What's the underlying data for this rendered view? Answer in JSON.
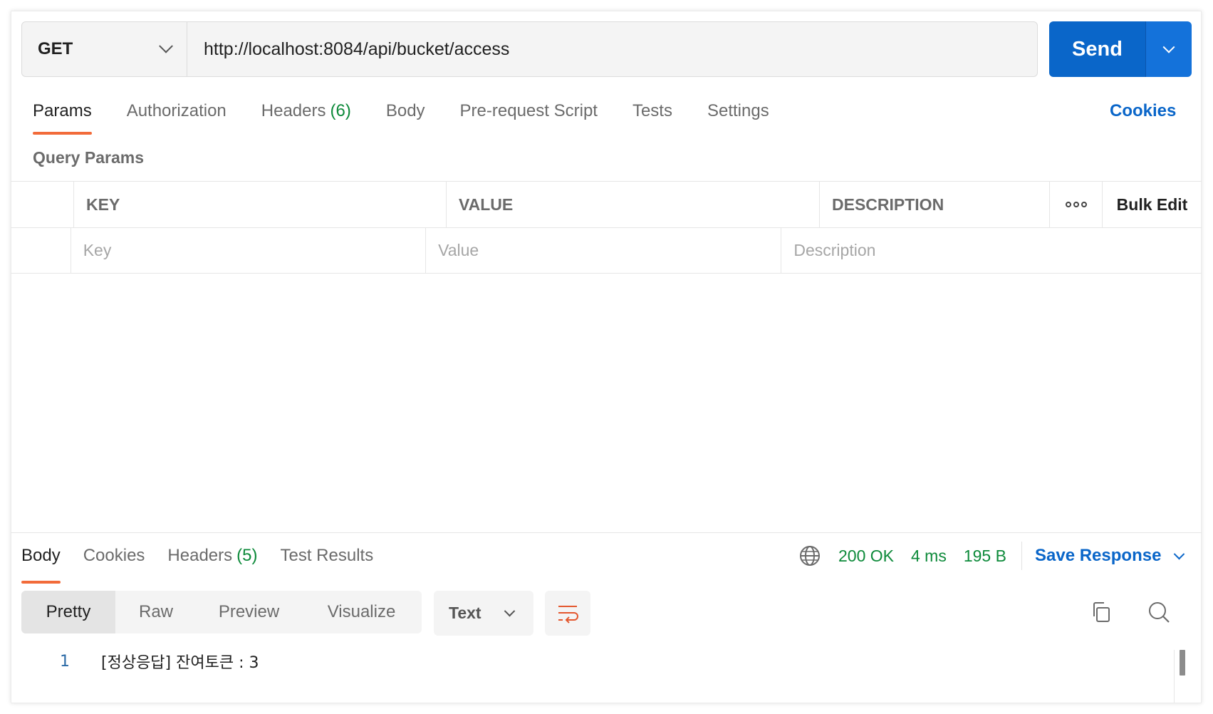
{
  "request": {
    "method": "GET",
    "url": "http://localhost:8084/api/bucket/access",
    "send_label": "Send"
  },
  "request_tabs": [
    {
      "label": "Params",
      "count": ""
    },
    {
      "label": "Authorization",
      "count": ""
    },
    {
      "label": "Headers",
      "count": "(6)"
    },
    {
      "label": "Body",
      "count": ""
    },
    {
      "label": "Pre-request Script",
      "count": ""
    },
    {
      "label": "Tests",
      "count": ""
    },
    {
      "label": "Settings",
      "count": ""
    }
  ],
  "cookies_label": "Cookies",
  "query_params": {
    "title": "Query Params",
    "headers": {
      "key": "KEY",
      "value": "VALUE",
      "description": "DESCRIPTION",
      "bulk_edit": "Bulk Edit"
    },
    "placeholders": {
      "key": "Key",
      "value": "Value",
      "description": "Description"
    }
  },
  "response": {
    "tabs": [
      {
        "label": "Body",
        "count": ""
      },
      {
        "label": "Cookies",
        "count": ""
      },
      {
        "label": "Headers",
        "count": "(5)"
      },
      {
        "label": "Test Results",
        "count": ""
      }
    ],
    "status": "200 OK",
    "time": "4 ms",
    "size": "195 B",
    "save_label": "Save Response",
    "modes": [
      "Pretty",
      "Raw",
      "Preview",
      "Visualize"
    ],
    "format": "Text",
    "lines": [
      {
        "number": "1",
        "text": "[정상응답] 잔여토큰 : 3"
      }
    ]
  },
  "icons": {
    "method_dropdown": "chevron-down-icon",
    "send_dropdown": "chevron-down-icon",
    "more": "more-options-icon",
    "globe": "globe-icon",
    "wrap": "word-wrap-icon",
    "copy": "copy-icon",
    "search": "search-icon"
  },
  "colors": {
    "accent_orange": "#f26b3a",
    "send_blue": "#0a66c9",
    "status_green": "#0d8a3a",
    "link_blue": "#0a66c9"
  }
}
